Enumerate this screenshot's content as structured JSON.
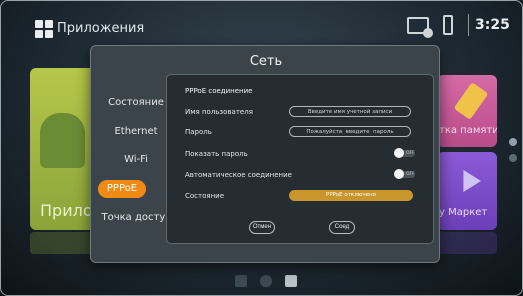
{
  "topbar": {
    "apps_title": "Приложения",
    "time": "3:25",
    "icons": [
      "apps-grid-icon",
      "network-disconnected-icon",
      "usb-icon"
    ]
  },
  "background_tiles": {
    "apps_label": "Прилож",
    "cleaner_label": "тка памяти",
    "market_label": "у Маркет"
  },
  "dialog": {
    "title": "Сеть",
    "menu": [
      {
        "label": "Состояние"
      },
      {
        "label": "Ethernet"
      },
      {
        "label": "Wi-Fi"
      },
      {
        "label": "PPPoE",
        "active": true
      },
      {
        "label": "Точка достуг"
      }
    ],
    "pppoe": {
      "heading": "PPPoE соединение",
      "username_label": "Имя пользователя",
      "username_placeholder": "Введите имя учетной записи",
      "password_label": "Пароль",
      "password_placeholder": "Пожалуйста  введите  пароль",
      "show_password_label": "Показать пароль",
      "show_password_state": "OFF",
      "auto_connect_label": "Автоматическое соединение",
      "auto_connect_state": "OFF",
      "status_label": "Состояние",
      "status_value": "PPPoE отключено",
      "cancel_label": "Отмен",
      "connect_label": "Соед"
    }
  },
  "colors": {
    "accent_orange": "#f08a12",
    "status_gold": "#c8962c",
    "dialog_bg": "#3b444a",
    "panel_bg": "#262d32"
  }
}
